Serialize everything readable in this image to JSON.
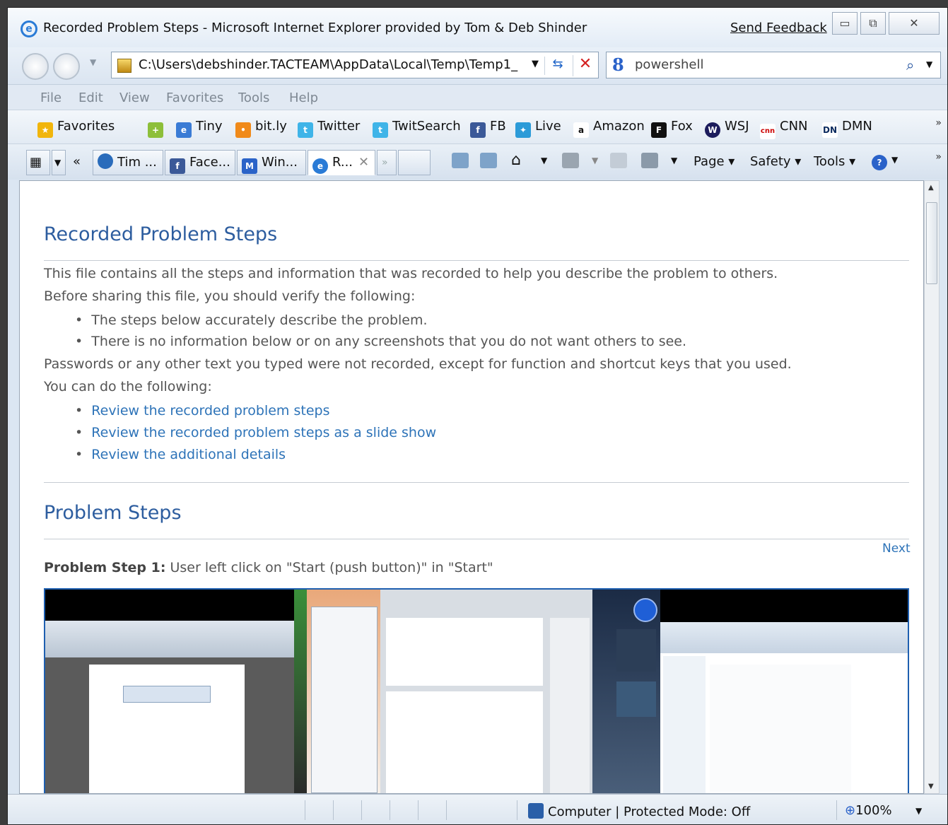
{
  "window": {
    "title": "Recorded Problem Steps - Microsoft Internet Explorer provided by Tom & Deb Shinder",
    "send_feedback": "Send Feedback",
    "minimize": "▭",
    "restore": "⧉",
    "close": "✕"
  },
  "address_bar": {
    "url": "C:\\Users\\debshinder.TACTEAM\\AppData\\Local\\Temp\\Temp1_",
    "search_value": "powershell",
    "search_logo": "8"
  },
  "menu": [
    "File",
    "Edit",
    "View",
    "Favorites",
    "Tools",
    "Help"
  ],
  "favorites_bar": {
    "favorites_label": "Favorites",
    "items": [
      "Tiny",
      "bit.ly",
      "Twitter",
      "TwitSearch",
      "FB",
      "Live",
      "Amazon",
      "Fox",
      "WSJ",
      "CNN",
      "DMN"
    ],
    "overflow": "»"
  },
  "tabs": {
    "items": [
      "Tim ...",
      "Face...",
      "Win...",
      "R..."
    ],
    "active_close": "✕",
    "overflow": "»",
    "back_chevron": "«"
  },
  "command_bar": {
    "page": "Page ▾",
    "safety": "Safety ▾",
    "tools": "Tools ▾",
    "help": "?",
    "overflow": "»"
  },
  "content": {
    "heading": "Recorded Problem Steps",
    "intro": "This file contains all the steps and information that was recorded to help you describe the problem to others.",
    "verify": "Before sharing this file, you should verify the following:",
    "verify_items": [
      "The steps below accurately describe the problem.",
      "There is no information below or on any screenshots that you do not want others to see."
    ],
    "passwords_note": "Passwords or any other text you typed were not recorded, except for function and shortcut keys that you used.",
    "can_do": "You can do the following:",
    "links": [
      "Review the recorded problem steps",
      "Review the recorded problem steps as a slide show",
      "Review the additional details"
    ],
    "problem_steps_heading": "Problem Steps",
    "next": "Next",
    "step1_label": "Problem Step 1:",
    "step1_text": " User left click on \"Start (push button)\" in \"Start\""
  },
  "status_bar": {
    "zone": "Computer | Protected Mode: Off",
    "zoom": "100%"
  },
  "colors": {
    "accent_heading": "#2d5d9f",
    "link": "#2d73b8",
    "body_text": "#555555"
  }
}
